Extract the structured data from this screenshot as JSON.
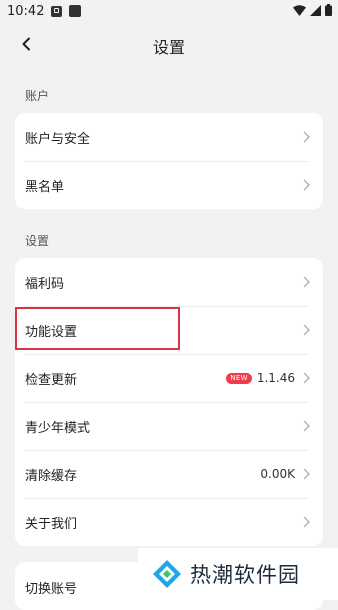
{
  "status_bar": {
    "time": "10:42"
  },
  "header": {
    "title": "设置"
  },
  "sections": {
    "account": {
      "label": "账户",
      "items": [
        {
          "label": "账户与安全"
        },
        {
          "label": "黑名单"
        }
      ]
    },
    "settings": {
      "label": "设置",
      "items": [
        {
          "label": "福利码"
        },
        {
          "label": "功能设置"
        },
        {
          "label": "检查更新",
          "badge": "NEW",
          "value": "1.1.46"
        },
        {
          "label": "青少年模式"
        },
        {
          "label": "清除缓存",
          "value": "0.00K"
        },
        {
          "label": "关于我们"
        }
      ]
    },
    "switch": {
      "items": [
        {
          "label": "切换账号"
        }
      ]
    }
  },
  "watermark": {
    "text": "热潮软件园"
  },
  "colors": {
    "background": "#f2f2f4",
    "card": "#ffffff",
    "badge": "#f03c4d",
    "highlight": "#d9343f",
    "chevron": "#b0b0b0"
  }
}
